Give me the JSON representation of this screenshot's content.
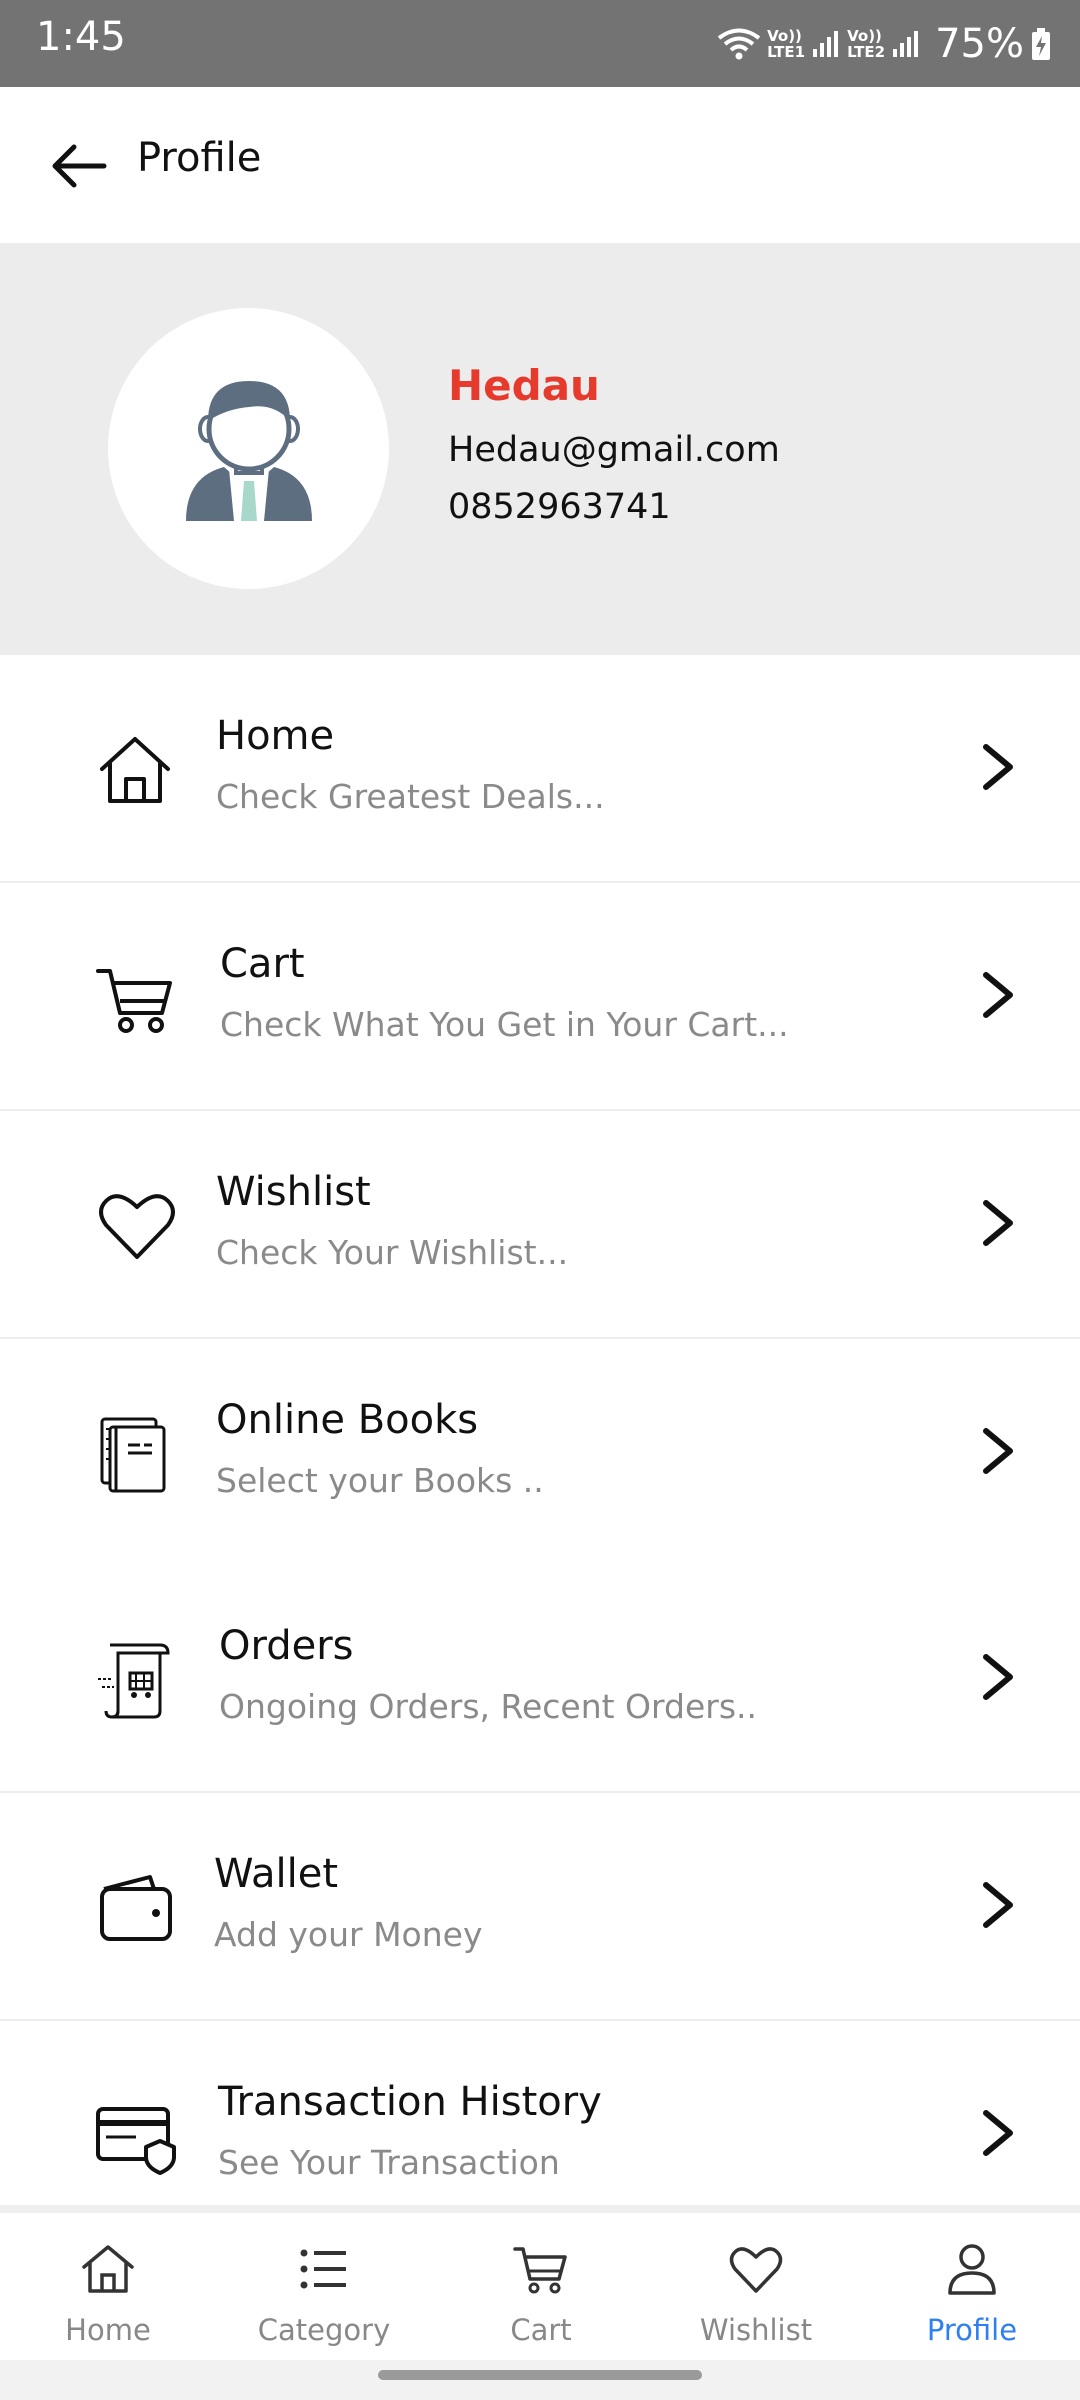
{
  "status_bar": {
    "time": "1:45",
    "battery": "75%",
    "sim1": "LTE1",
    "sim2": "LTE2",
    "volte": "Vo))"
  },
  "app_bar": {
    "title": "Profile",
    "back_icon": "back-arrow-icon"
  },
  "profile": {
    "name": "Hedau",
    "email": "Hedau@gmail.com",
    "phone": "0852963741",
    "name_color": "#e53a2c"
  },
  "menu": {
    "items": [
      {
        "title": "Home",
        "subtitle": "Check Greatest Deals...",
        "icon": "home-icon"
      },
      {
        "title": "Cart",
        "subtitle": "Check What You Get in Your Cart...",
        "icon": "cart-icon"
      },
      {
        "title": "Wishlist",
        "subtitle": "Check Your Wishlist...",
        "icon": "heart-icon"
      },
      {
        "title": "Online Books",
        "subtitle": "Select your Books ..",
        "icon": "books-icon"
      },
      {
        "title": "Orders",
        "subtitle": "Ongoing Orders, Recent Orders..",
        "icon": "orders-icon"
      },
      {
        "title": "Wallet",
        "subtitle": "Add your Money",
        "icon": "wallet-icon"
      },
      {
        "title": "Transaction History",
        "subtitle": "See Your Transaction",
        "icon": "credit-card-shield-icon"
      }
    ]
  },
  "bottom_nav": {
    "active": "Profile",
    "active_color": "#2f7ff0",
    "items": [
      {
        "label": "Home",
        "icon": "home-icon"
      },
      {
        "label": "Category",
        "icon": "list-icon"
      },
      {
        "label": "Cart",
        "icon": "cart-icon"
      },
      {
        "label": "Wishlist",
        "icon": "heart-icon"
      },
      {
        "label": "Profile",
        "icon": "person-icon"
      }
    ]
  }
}
